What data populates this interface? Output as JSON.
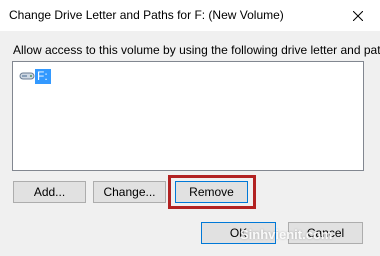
{
  "window": {
    "title": "Change Drive Letter and Paths for F: (New Volume)",
    "close_icon": "close-icon"
  },
  "instruction": "Allow access to this volume by using the following drive letter and paths:",
  "list": {
    "items": [
      {
        "label": "F:",
        "icon": "drive-icon",
        "selected": true
      }
    ]
  },
  "buttons": {
    "add": "Add...",
    "change": "Change...",
    "remove": "Remove",
    "ok": "OK",
    "cancel": "Cancel"
  },
  "colors": {
    "selection": "#3399ff",
    "highlight_frame": "#b22222",
    "focus_border": "#0078d7"
  },
  "watermark": "Sinhvienit.com"
}
